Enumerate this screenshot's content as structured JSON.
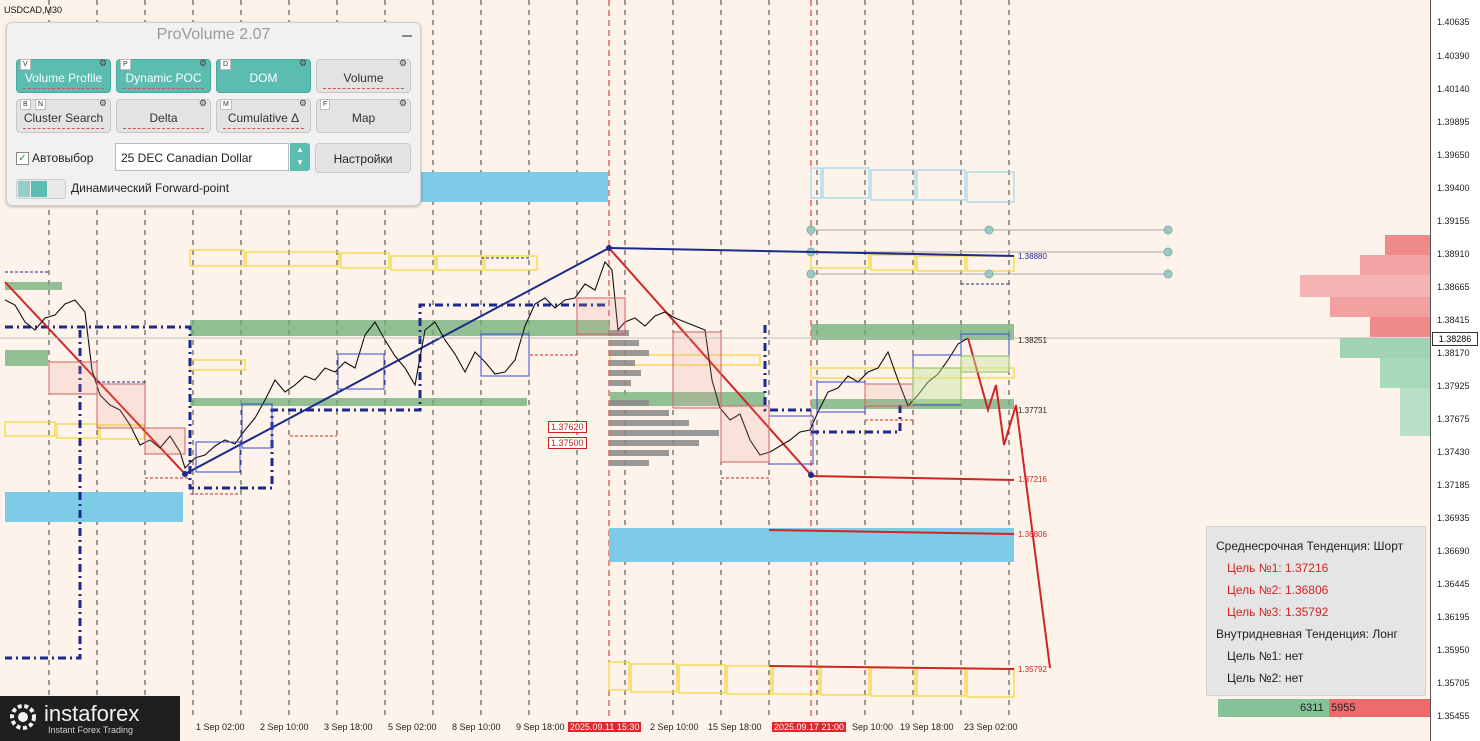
{
  "symbol": "USDCAD,M30",
  "panel": {
    "title": "ProVolume 2.07",
    "buttons": [
      {
        "key": "V",
        "label": "Volume Profile",
        "state": "on"
      },
      {
        "key": "P",
        "label": "Dynamic POC",
        "state": "on"
      },
      {
        "key": "D",
        "label": "DOM",
        "state": "on"
      },
      {
        "key": "",
        "label": "Volume",
        "state": "off"
      },
      {
        "key": "B",
        "key2": "N",
        "label": "Cluster Search",
        "state": "off"
      },
      {
        "key": "",
        "label": "Delta",
        "state": "off"
      },
      {
        "key": "M",
        "label": "Cumulative Δ",
        "state": "off"
      },
      {
        "key": "F",
        "label": "Map",
        "state": "off"
      }
    ],
    "auto_label": "Автовыбор",
    "instrument": "25 DEC Canadian Dollar",
    "settings_label": "Настройки",
    "forward_label": "Динамический Forward-point"
  },
  "price_axis": {
    "labels": [
      "1.40635",
      "1.40390",
      "1.40140",
      "1.39895",
      "1.39650",
      "1.39400",
      "1.39155",
      "1.38910",
      "1.38665",
      "1.38415",
      "1.38170",
      "1.37925",
      "1.37675",
      "1.37430",
      "1.37185",
      "1.36935",
      "1.36690",
      "1.36445",
      "1.36195",
      "1.35950",
      "1.35705",
      "1.35455"
    ],
    "current": "1.38286"
  },
  "date_axis": [
    {
      "label": "1 Sep 02:00",
      "hl": false
    },
    {
      "label": "2 Sep 10:00",
      "hl": false
    },
    {
      "label": "3 Sep 18:00",
      "hl": false
    },
    {
      "label": "5 Sep 02:00",
      "hl": false
    },
    {
      "label": "8 Sep 10:00",
      "hl": false
    },
    {
      "label": "9 Sep 18:00",
      "hl": false
    },
    {
      "label": "2025.09.11 15:30",
      "hl": true
    },
    {
      "label": "2 Sep 10:00",
      "hl": false
    },
    {
      "label": "15 Sep 18:00",
      "hl": false
    },
    {
      "label": "2025.09.17 21:00",
      "hl": true
    },
    {
      "label": "Sep 10:00",
      "hl": false
    },
    {
      "label": "19 Sep 18:00",
      "hl": false
    },
    {
      "label": "23 Sep 02:00",
      "hl": false
    }
  ],
  "levels": {
    "l1": "1.38880",
    "l2": "1.38251",
    "l3": "1.37731",
    "l4": "1.37216",
    "l5": "1.36806",
    "l6": "1.35792",
    "box1": "1.37620",
    "box2": "1.37500"
  },
  "info": {
    "mid_trend": "Среднесрочная Тенденция: Шорт",
    "mid_targets": [
      "Цель №1: 1.37216",
      "Цель №2: 1.36806",
      "Цель №3: 1.35792"
    ],
    "intra_trend": "Внутридневная Тенденция: Лонг",
    "intra_targets": [
      "Цель №1: нет",
      "Цель №2: нет"
    ]
  },
  "volume_bar": {
    "buy": "6311",
    "sell": "5955"
  },
  "logo": {
    "brand": "instaforex",
    "tagline": "Instant Forex Trading"
  },
  "colors": {
    "accent": "#5bbcb0",
    "trend_blue": "#1c2a8c",
    "trend_red": "#d12424",
    "zone_blue": "#7ecbe8",
    "zone_green": "#6fae78",
    "zone_yellow": "#f2d531"
  }
}
